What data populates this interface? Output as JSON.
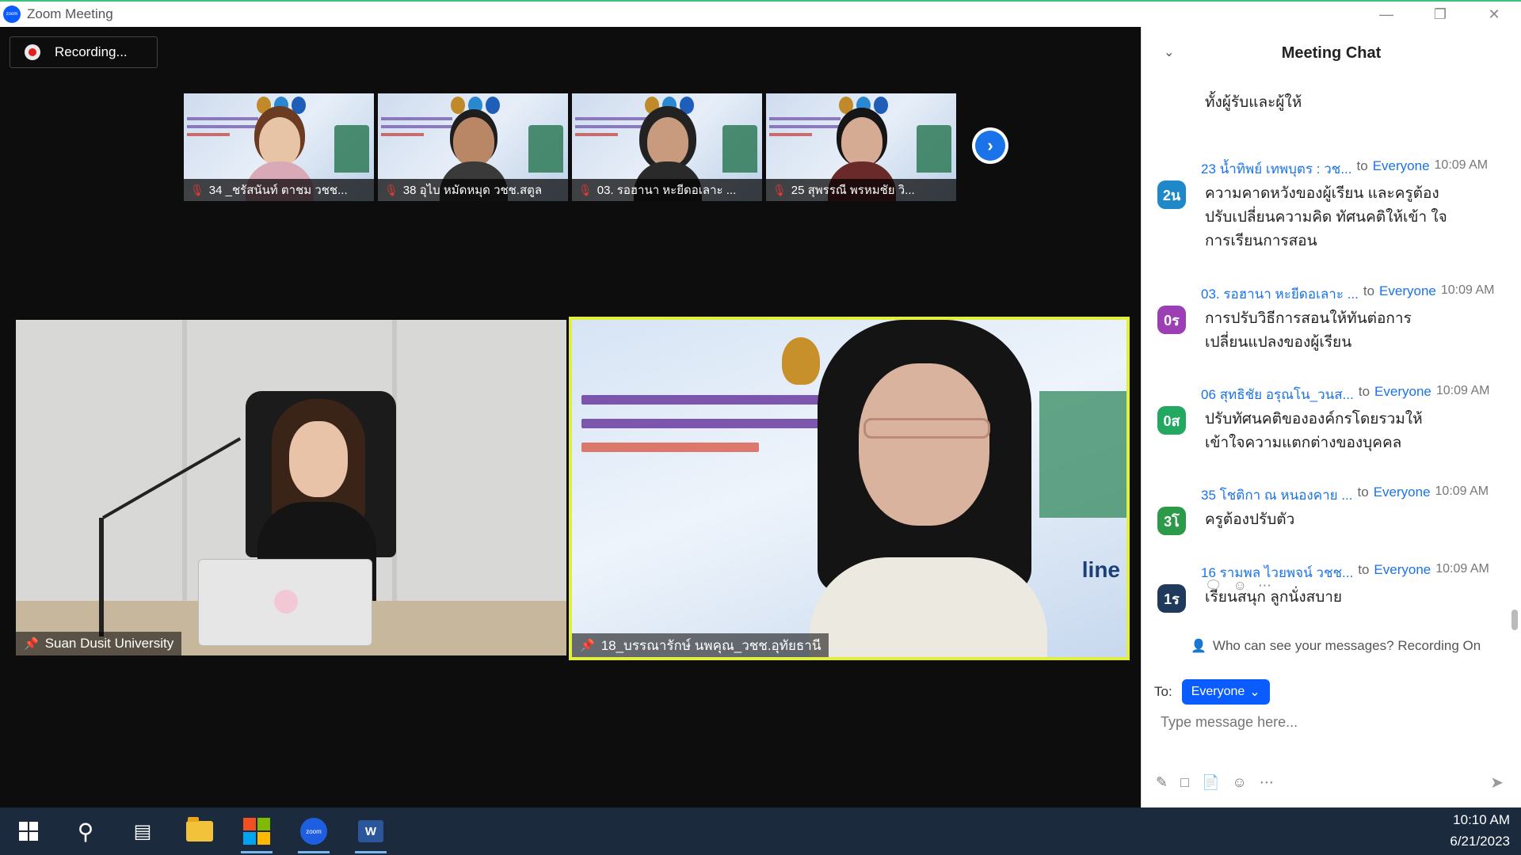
{
  "window": {
    "title": "Zoom Meeting",
    "app_icon_label": "zoom",
    "controls": [
      "minimize",
      "restore",
      "close"
    ]
  },
  "meeting": {
    "recording_label": "Recording...",
    "participants_strip": [
      {
        "name": "34 _ชรัสนันท์ ตาชม วชช..."
      },
      {
        "name": "38 อุไบ หมัดหมุด วชช.สตูล"
      },
      {
        "name": "03. รอฮานา หะยีดอเลาะ ..."
      },
      {
        "name": "25 สุพรรณี  พรหมชัย วิ..."
      }
    ],
    "next_page_icon": "chevron-right-icon",
    "main_tiles": {
      "left_name": "Suan Dusit University",
      "right_name": "18_บรรณารักษ์ นพคุณ_วชช.อุทัยธานี",
      "slide_word": "line"
    }
  },
  "chat": {
    "title": "Meeting Chat",
    "partial_message": "ทั้งผู้รับและผู้ให้",
    "messages": [
      {
        "sender": "23 น้ำทิพย์ เทพบุตร : วช...",
        "to": "to",
        "target": "Everyone",
        "time": "10:09 AM",
        "avatar": "2น",
        "avatar_color": "#1e88c8",
        "text": "ความคาดหวังของผู้เรียน และครูต้อง ปรับเปลี่ยนความคิด ทัศนคติให้เข้า ใจการเรียนการสอน"
      },
      {
        "sender": "03. รอฮานา หะยีดอเลาะ ...",
        "to": "to",
        "target": "Everyone",
        "time": "10:09 AM",
        "avatar": "0ร",
        "avatar_color": "#9c3fb5",
        "text": "การปรับวิธีการสอนให้ทันต่อการ เปลี่ยนแปลงของผู้เรียน"
      },
      {
        "sender": "06 สุทธิชัย อรุณโน_วนส...",
        "to": "to",
        "target": "Everyone",
        "time": "10:09 AM",
        "avatar": "0ส",
        "avatar_color": "#22a860",
        "text": "ปรับทัศนคติขององค์กรโดยรวมให้ เข้าใจความแตกต่างของบุคคล"
      },
      {
        "sender": "35 โชติกา ณ หนองคาย ...",
        "to": "to",
        "target": "Everyone",
        "time": "10:09 AM",
        "avatar": "3โ",
        "avatar_color": "#2d9a4a",
        "text": "ครูต้องปรับตัว"
      },
      {
        "sender": "16 รามพล ไวยพจน์ วชช...",
        "to": "to",
        "target": "Everyone",
        "time": "10:09 AM",
        "avatar": "1ร",
        "avatar_color": "#1f3a5a",
        "text": "เรียนสนุก ลูกนั่งสบาย"
      }
    ],
    "visibility_note": "Who can see your messages? Recording On",
    "to_label": "To:",
    "recipient": "Everyone",
    "input_placeholder": "Type message here...",
    "accent_color": "#0b5cff"
  },
  "taskbar": {
    "items": [
      "start",
      "search",
      "task-view",
      "file-explorer",
      "microsoft-store",
      "zoom",
      "word"
    ],
    "zoom_label": "zoom",
    "word_label": "W",
    "time": "10:10 AM",
    "date": "6/21/2023"
  }
}
